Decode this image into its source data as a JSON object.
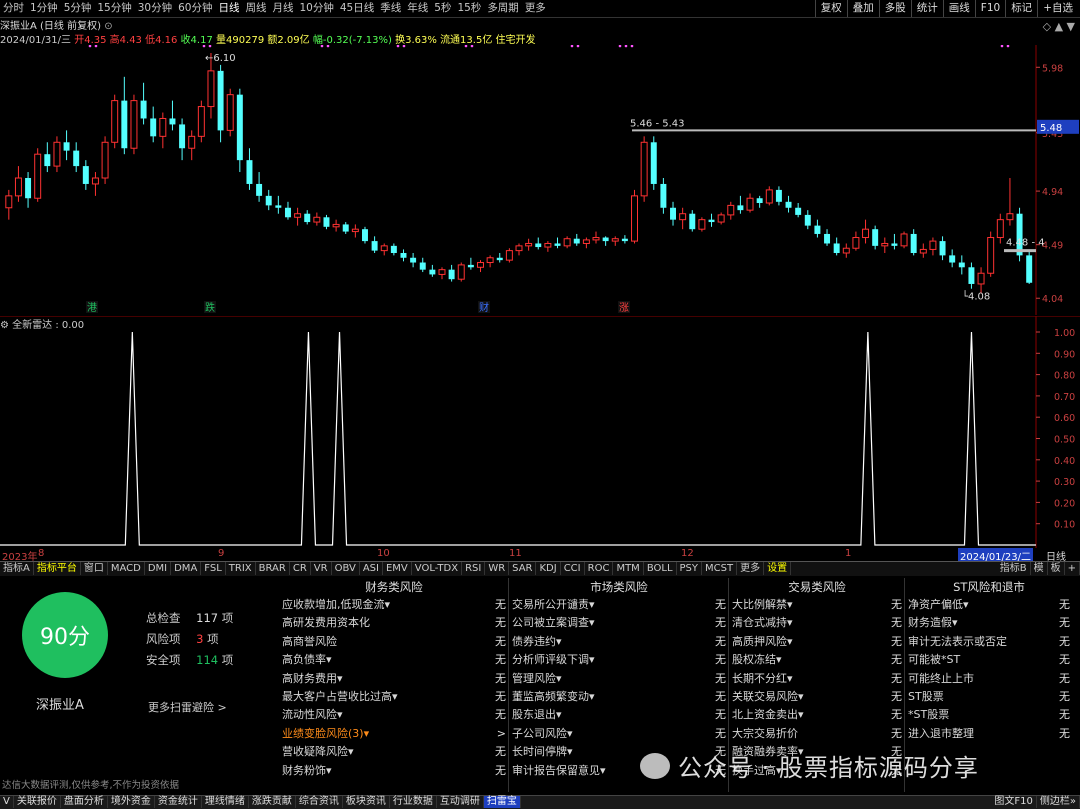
{
  "toolbar": {
    "periods": [
      "分时",
      "1分钟",
      "5分钟",
      "15分钟",
      "30分钟",
      "60分钟",
      "日线",
      "周线",
      "月线",
      "10分钟",
      "45日线",
      "季线",
      "年线",
      "5秒",
      "15秒",
      "多周期",
      "更多"
    ],
    "active": "日线",
    "right_buttons": [
      "复权",
      "叠加",
      "多股",
      "统计",
      "画线",
      "F10",
      "标记",
      "+自选"
    ]
  },
  "stock": {
    "title": "深振业A (日线 前复权)",
    "date": "2024/01/31/三",
    "open": "开4.35",
    "high": "高4.43",
    "low": "低4.16",
    "close": "收4.17",
    "vol": "量490279",
    "amount": "额2.09亿",
    "change": "幅-0.32(-7.13%)",
    "turnover": "换3.63%",
    "float_cap": "流通13.5亿",
    "concept": "住宅开发"
  },
  "price_axis": [
    "5.98",
    "5.43",
    "4.94",
    "4.49",
    "4.04"
  ],
  "current_price": "5.48",
  "annotations": {
    "high": "6.10",
    "low": "4.08",
    "range": "5.46 - 5.43",
    "right": "4.48 - 4"
  },
  "markers": [
    "港",
    "跌",
    "财",
    "涨"
  ],
  "indicator": {
    "title": "全新雷达 : 0.00",
    "axis": [
      "1.00",
      "0.90",
      "0.80",
      "0.70",
      "0.60",
      "0.50",
      "0.40",
      "0.30",
      "0.20",
      "0.10"
    ]
  },
  "time_axis": [
    "2023年",
    "8",
    "9",
    "10",
    "11",
    "12",
    "1",
    "2024/01/23/二",
    "日线"
  ],
  "tabs": [
    "指标A",
    "指标平台",
    "窗口",
    "MACD",
    "DMI",
    "DMA",
    "FSL",
    "TRIX",
    "BRAR",
    "CR",
    "VR",
    "OBV",
    "ASI",
    "EMV",
    "VOL-TDX",
    "RSI",
    "WR",
    "SAR",
    "KDJ",
    "CCI",
    "ROC",
    "MTM",
    "BOLL",
    "PSY",
    "MCST",
    "更多",
    "设置"
  ],
  "tabs_right": [
    "指标B",
    "模",
    "板",
    "+"
  ],
  "score": {
    "value": "90分",
    "stock_name": "深振业A",
    "total_label": "总检查",
    "total": "117",
    "risk_label": "风险项",
    "risk": "3",
    "safe_label": "安全项",
    "safe": "114",
    "unit": "项",
    "more": "更多扫雷避险 >",
    "disclaimer": "达信大数据评测,仅供参考,不作为投资依据"
  },
  "risk_columns": [
    {
      "title": "财务类风险",
      "items": [
        [
          "应收款增加,低现金流▾",
          "无"
        ],
        [
          "高研发费用资本化",
          "无"
        ],
        [
          "高商誉风险",
          "无"
        ],
        [
          "高负债率▾",
          "无"
        ],
        [
          "高财务费用▾",
          "无"
        ],
        [
          "最大客户占营收比过高▾",
          "无"
        ],
        [
          "流动性风险▾",
          "无"
        ],
        [
          "业绩变脸风险(3)▾",
          ">"
        ],
        [
          "营收疑降风险▾",
          "无"
        ],
        [
          "财务粉饰▾",
          "无"
        ]
      ]
    },
    {
      "title": "市场类风险",
      "items": [
        [
          "交易所公开谴责▾",
          "无"
        ],
        [
          "公司被立案调查▾",
          "无"
        ],
        [
          "债券违约▾",
          "无"
        ],
        [
          "分析师评级下调▾",
          "无"
        ],
        [
          "管理风险▾",
          "无"
        ],
        [
          "董监高频繁变动▾",
          "无"
        ],
        [
          "股东退出▾",
          "无"
        ],
        [
          "子公司风险▾",
          "无"
        ],
        [
          "长时间停牌▾",
          "无"
        ],
        [
          "审计报告保留意见▾",
          "无"
        ]
      ]
    },
    {
      "title": "交易类风险",
      "items": [
        [
          "大比例解禁▾",
          "无"
        ],
        [
          "清仓式减持▾",
          "无"
        ],
        [
          "高质押风险▾",
          "无"
        ],
        [
          "股权冻结▾",
          "无"
        ],
        [
          "长期不分红▾",
          "无"
        ],
        [
          "关联交易风险▾",
          "无"
        ],
        [
          "北上资金卖出▾",
          "无"
        ],
        [
          "大宗交易折价",
          "无"
        ],
        [
          "融资融券卖率▾",
          "无"
        ],
        [
          "换手过高▾",
          "无"
        ]
      ]
    },
    {
      "title": "ST风险和退市",
      "items": [
        [
          "净资产偏低▾",
          "无"
        ],
        [
          "财务造假▾",
          "无"
        ],
        [
          "审计无法表示或否定",
          "无"
        ],
        [
          "可能被*ST",
          "无"
        ],
        [
          "可能终止上市",
          "无"
        ],
        [
          "ST股票",
          "无"
        ],
        [
          "*ST股票",
          "无"
        ],
        [
          "进入退市整理",
          "无"
        ]
      ]
    }
  ],
  "watermark": "公众号 · 股票指标源码分享",
  "bottom_tabs": [
    "V",
    "关联报价",
    "盘面分析",
    "境外资金",
    "资金统计",
    "理线情绪",
    "涨跌贡献",
    "综合资讯",
    "板块资讯",
    "行业数据",
    "互动调研",
    "扫雷宝"
  ],
  "bottom_right": [
    "图文F10",
    "侧边栏»"
  ],
  "colors": {
    "up": "#ff3232",
    "down": "#54ffff",
    "bg": "#000000",
    "grid": "#8b0000",
    "score_green": "#1fbf5f"
  },
  "chart_data": {
    "type": "candlestick",
    "series": [
      {
        "name": "K",
        "ohlc": [
          [
            4.8,
            4.95,
            4.7,
            4.9
          ],
          [
            4.9,
            5.15,
            4.85,
            5.05
          ],
          [
            5.05,
            5.1,
            4.8,
            4.88
          ],
          [
            4.88,
            5.3,
            4.85,
            5.25
          ],
          [
            5.25,
            5.35,
            5.1,
            5.15
          ],
          [
            5.15,
            5.4,
            5.1,
            5.35
          ],
          [
            5.35,
            5.45,
            5.2,
            5.28
          ],
          [
            5.28,
            5.35,
            5.1,
            5.15
          ],
          [
            5.15,
            5.2,
            4.95,
            5.0
          ],
          [
            5.0,
            5.1,
            4.9,
            5.05
          ],
          [
            5.05,
            5.4,
            5.0,
            5.35
          ],
          [
            5.35,
            5.75,
            5.3,
            5.7
          ],
          [
            5.7,
            5.9,
            5.25,
            5.3
          ],
          [
            5.3,
            5.75,
            5.25,
            5.7
          ],
          [
            5.7,
            5.85,
            5.5,
            5.55
          ],
          [
            5.55,
            5.65,
            5.35,
            5.4
          ],
          [
            5.4,
            5.6,
            5.3,
            5.55
          ],
          [
            5.55,
            5.7,
            5.45,
            5.5
          ],
          [
            5.5,
            5.55,
            5.2,
            5.3
          ],
          [
            5.3,
            5.45,
            5.2,
            5.4
          ],
          [
            5.4,
            5.7,
            5.35,
            5.65
          ],
          [
            5.65,
            6.1,
            5.55,
            5.95
          ],
          [
            5.95,
            6.0,
            5.35,
            5.45
          ],
          [
            5.45,
            5.8,
            5.4,
            5.75
          ],
          [
            5.75,
            5.8,
            5.1,
            5.2
          ],
          [
            5.2,
            5.3,
            4.95,
            5.0
          ],
          [
            5.0,
            5.1,
            4.85,
            4.9
          ],
          [
            4.9,
            4.95,
            4.78,
            4.82
          ],
          [
            4.82,
            4.9,
            4.75,
            4.8
          ],
          [
            4.8,
            4.85,
            4.7,
            4.72
          ],
          [
            4.72,
            4.8,
            4.65,
            4.75
          ],
          [
            4.75,
            4.78,
            4.66,
            4.68
          ],
          [
            4.68,
            4.76,
            4.65,
            4.72
          ],
          [
            4.72,
            4.74,
            4.62,
            4.64
          ],
          [
            4.64,
            4.7,
            4.6,
            4.66
          ],
          [
            4.66,
            4.68,
            4.58,
            4.6
          ],
          [
            4.6,
            4.66,
            4.55,
            4.62
          ],
          [
            4.62,
            4.64,
            4.5,
            4.52
          ],
          [
            4.52,
            4.56,
            4.42,
            4.44
          ],
          [
            4.44,
            4.5,
            4.4,
            4.48
          ],
          [
            4.48,
            4.5,
            4.4,
            4.42
          ],
          [
            4.42,
            4.45,
            4.35,
            4.38
          ],
          [
            4.38,
            4.42,
            4.3,
            4.34
          ],
          [
            4.34,
            4.38,
            4.26,
            4.28
          ],
          [
            4.28,
            4.32,
            4.22,
            4.24
          ],
          [
            4.24,
            4.3,
            4.2,
            4.28
          ],
          [
            4.28,
            4.32,
            4.18,
            4.2
          ],
          [
            4.2,
            4.34,
            4.18,
            4.32
          ],
          [
            4.32,
            4.38,
            4.28,
            4.3
          ],
          [
            4.3,
            4.36,
            4.26,
            4.34
          ],
          [
            4.34,
            4.4,
            4.3,
            4.38
          ],
          [
            4.38,
            4.42,
            4.34,
            4.36
          ],
          [
            4.36,
            4.46,
            4.34,
            4.44
          ],
          [
            4.44,
            4.5,
            4.4,
            4.48
          ],
          [
            4.48,
            4.54,
            4.44,
            4.5
          ],
          [
            4.5,
            4.55,
            4.45,
            4.47
          ],
          [
            4.47,
            4.52,
            4.43,
            4.5
          ],
          [
            4.5,
            4.55,
            4.46,
            4.48
          ],
          [
            4.48,
            4.56,
            4.46,
            4.54
          ],
          [
            4.54,
            4.58,
            4.48,
            4.5
          ],
          [
            4.5,
            4.55,
            4.46,
            4.53
          ],
          [
            4.53,
            4.6,
            4.5,
            4.55
          ],
          [
            4.55,
            4.56,
            4.48,
            4.52
          ],
          [
            4.52,
            4.56,
            4.48,
            4.54
          ],
          [
            4.54,
            4.57,
            4.5,
            4.52
          ],
          [
            4.52,
            4.95,
            4.5,
            4.9
          ],
          [
            4.9,
            5.4,
            4.85,
            5.35
          ],
          [
            5.35,
            5.4,
            4.95,
            5.0
          ],
          [
            5.0,
            5.05,
            4.75,
            4.8
          ],
          [
            4.8,
            4.85,
            4.65,
            4.7
          ],
          [
            4.7,
            4.8,
            4.62,
            4.75
          ],
          [
            4.75,
            4.78,
            4.6,
            4.62
          ],
          [
            4.62,
            4.72,
            4.6,
            4.7
          ],
          [
            4.7,
            4.75,
            4.64,
            4.68
          ],
          [
            4.68,
            4.76,
            4.66,
            4.74
          ],
          [
            4.74,
            4.85,
            4.7,
            4.82
          ],
          [
            4.82,
            4.9,
            4.75,
            4.78
          ],
          [
            4.78,
            4.92,
            4.76,
            4.88
          ],
          [
            4.88,
            4.9,
            4.8,
            4.84
          ],
          [
            4.84,
            4.98,
            4.82,
            4.95
          ],
          [
            4.95,
            4.98,
            4.82,
            4.85
          ],
          [
            4.85,
            4.9,
            4.76,
            4.8
          ],
          [
            4.8,
            4.84,
            4.72,
            4.74
          ],
          [
            4.74,
            4.78,
            4.62,
            4.65
          ],
          [
            4.65,
            4.7,
            4.55,
            4.58
          ],
          [
            4.58,
            4.62,
            4.48,
            4.5
          ],
          [
            4.5,
            4.55,
            4.4,
            4.42
          ],
          [
            4.42,
            4.5,
            4.38,
            4.46
          ],
          [
            4.46,
            4.6,
            4.44,
            4.55
          ],
          [
            4.55,
            4.7,
            4.5,
            4.62
          ],
          [
            4.62,
            4.65,
            4.45,
            4.48
          ],
          [
            4.48,
            4.55,
            4.42,
            4.5
          ],
          [
            4.5,
            4.58,
            4.45,
            4.48
          ],
          [
            4.48,
            4.6,
            4.46,
            4.58
          ],
          [
            4.58,
            4.62,
            4.4,
            4.42
          ],
          [
            4.42,
            4.5,
            4.38,
            4.45
          ],
          [
            4.45,
            4.55,
            4.4,
            4.52
          ],
          [
            4.52,
            4.56,
            4.36,
            4.4
          ],
          [
            4.4,
            4.45,
            4.3,
            4.34
          ],
          [
            4.34,
            4.4,
            4.24,
            4.3
          ],
          [
            4.3,
            4.34,
            4.12,
            4.16
          ],
          [
            4.16,
            4.3,
            4.08,
            4.25
          ],
          [
            4.25,
            4.6,
            4.22,
            4.55
          ],
          [
            4.55,
            4.75,
            4.5,
            4.7
          ],
          [
            4.7,
            5.05,
            4.65,
            4.75
          ],
          [
            4.75,
            4.8,
            4.35,
            4.4
          ],
          [
            4.4,
            4.43,
            4.16,
            4.17
          ]
        ]
      }
    ],
    "signal": {
      "name": "全新雷达",
      "spike_positions": [
        0.12,
        0.29,
        0.32,
        0.83,
        0.93
      ],
      "ylim": [
        0,
        1.0
      ]
    },
    "ylim": [
      4.0,
      6.1
    ]
  }
}
